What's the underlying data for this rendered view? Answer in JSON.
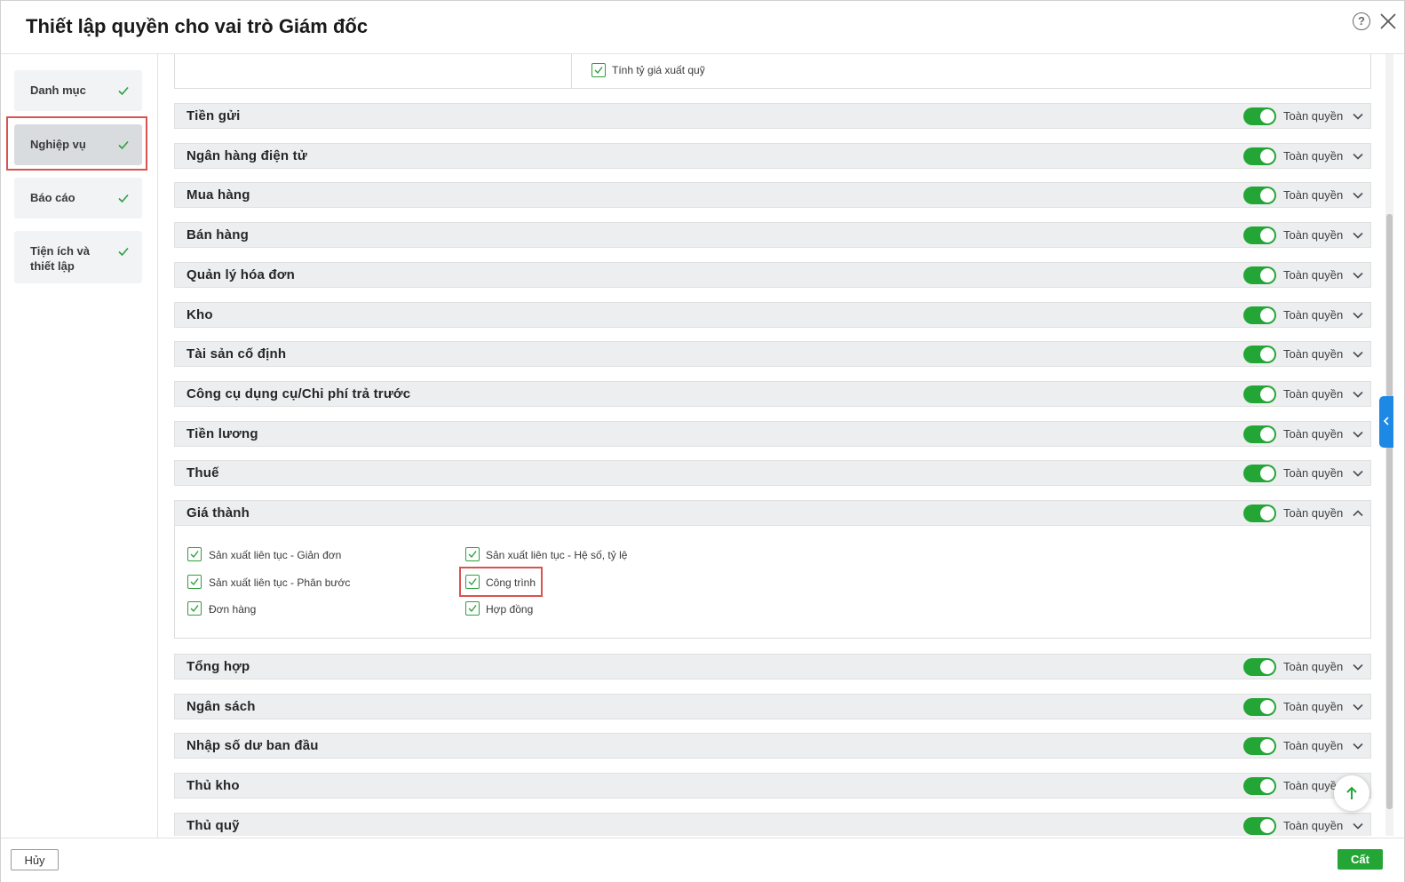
{
  "dialog": {
    "title": "Thiết lập quyền cho vai trò Giám đốc",
    "help_icon": "question-circle-icon",
    "close_icon": "close-icon"
  },
  "sidebar": {
    "items": [
      {
        "label": "Danh mục",
        "checked": true,
        "active": false
      },
      {
        "label": "Nghiệp vụ",
        "checked": true,
        "active": true
      },
      {
        "label": "Báo cáo",
        "checked": true,
        "active": false
      },
      {
        "label": "Tiện ích và thiết lập",
        "checked": true,
        "active": false
      }
    ]
  },
  "top_partial": {
    "checkbox_label": "Tính tỷ giá xuất quỹ",
    "checked": true
  },
  "permission_label": "Toàn quyền",
  "sections": [
    {
      "title": "Tiền gửi",
      "enabled": true,
      "expanded": false
    },
    {
      "title": "Ngân hàng điện tử",
      "enabled": true,
      "expanded": false
    },
    {
      "title": "Mua hàng",
      "enabled": true,
      "expanded": false
    },
    {
      "title": "Bán hàng",
      "enabled": true,
      "expanded": false
    },
    {
      "title": "Quản lý hóa đơn",
      "enabled": true,
      "expanded": false
    },
    {
      "title": "Kho",
      "enabled": true,
      "expanded": false
    },
    {
      "title": "Tài sản cố định",
      "enabled": true,
      "expanded": false
    },
    {
      "title": "Công cụ dụng cụ/Chi phí trả trước",
      "enabled": true,
      "expanded": false
    },
    {
      "title": "Tiền lương",
      "enabled": true,
      "expanded": false
    },
    {
      "title": "Thuế",
      "enabled": true,
      "expanded": false
    },
    {
      "title": "Giá thành",
      "enabled": true,
      "expanded": true
    },
    {
      "title": "Tổng hợp",
      "enabled": true,
      "expanded": false
    },
    {
      "title": "Ngân sách",
      "enabled": true,
      "expanded": false
    },
    {
      "title": "Nhập số dư ban đầu",
      "enabled": true,
      "expanded": false
    },
    {
      "title": "Thủ kho",
      "enabled": true,
      "expanded": false
    },
    {
      "title": "Thủ quỹ",
      "enabled": true,
      "expanded": false
    }
  ],
  "gia_thanh_options": [
    {
      "label": "Sản xuất liên tục - Giản đơn",
      "checked": true
    },
    {
      "label": "Sản xuất liên tục - Hệ số, tỷ lệ",
      "checked": true
    },
    {
      "label": "Sản xuất liên tục - Phân bước",
      "checked": true
    },
    {
      "label": "Công trình",
      "checked": true
    },
    {
      "label": "Đơn hàng",
      "checked": true
    },
    {
      "label": "Hợp đồng",
      "checked": true
    }
  ],
  "footer": {
    "cancel_label": "Hủy",
    "save_label": "Cất"
  },
  "colors": {
    "accent_green": "#23a636",
    "highlight_red": "#d9534f",
    "side_tab_blue": "#1e88e5"
  }
}
